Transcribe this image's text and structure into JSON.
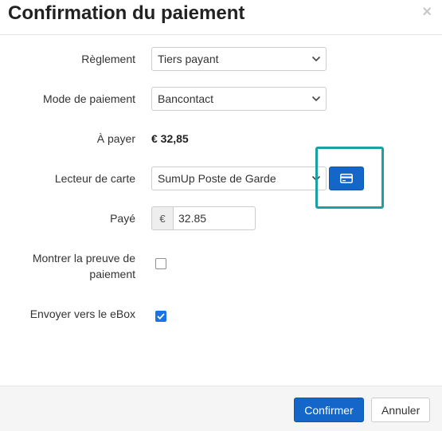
{
  "dialog": {
    "title": "Confirmation du paiement",
    "close_label": "×"
  },
  "form": {
    "reglement": {
      "label": "Règlement",
      "value": "Tiers payant"
    },
    "mode_paiement": {
      "label": "Mode de paiement",
      "value": "Bancontact"
    },
    "a_payer": {
      "label": "À payer",
      "value": "€ 32,85"
    },
    "lecteur_carte": {
      "label": "Lecteur de carte",
      "value": "SumUp Poste de Garde",
      "button_icon": "credit-card-icon"
    },
    "paye": {
      "label": "Payé",
      "currency": "€",
      "value": "32.85"
    },
    "preuve_paiement": {
      "label_line1": "Montrer la preuve de",
      "label_line2": "paiement",
      "checked": false
    },
    "ebox": {
      "label": "Envoyer vers le eBox",
      "checked": true
    }
  },
  "footer": {
    "confirm_label": "Confirmer",
    "cancel_label": "Annuler"
  },
  "colors": {
    "primary": "#1467c8",
    "highlight": "#1aa1a6",
    "checkbox_checked": "#1a73e8"
  }
}
